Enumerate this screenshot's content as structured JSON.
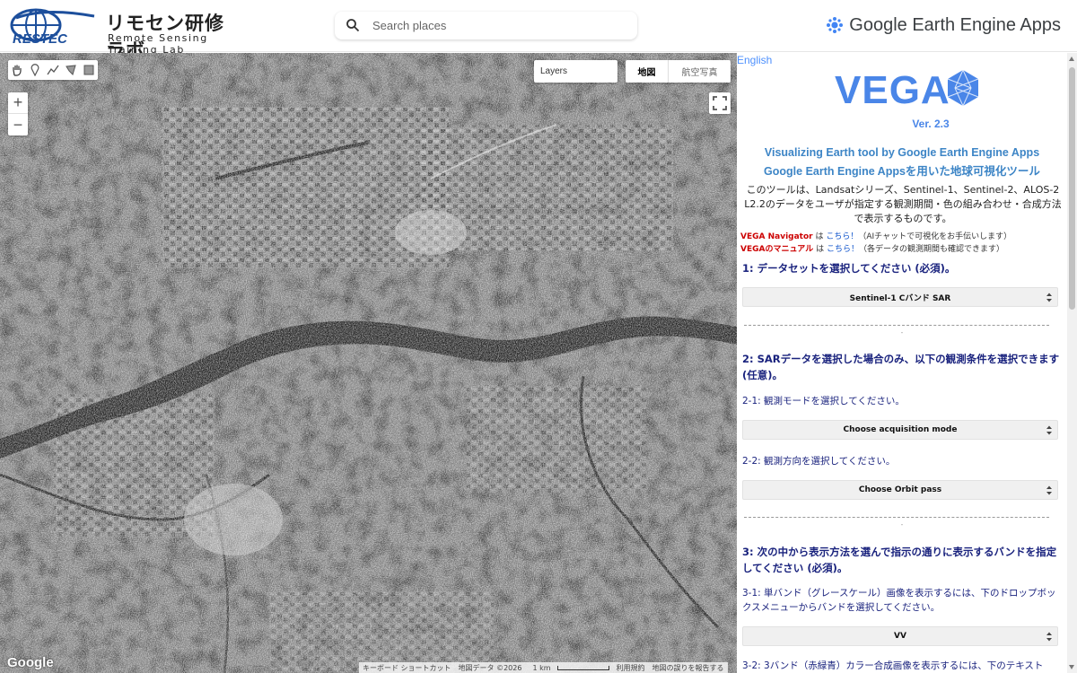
{
  "header": {
    "logo_brand": "RESTEC",
    "logo_jp": "リモセン研修ラボ",
    "logo_en": "Remote Sensing Training Lab",
    "search_placeholder": "Search places",
    "app_title": "Google Earth Engine Apps"
  },
  "map": {
    "draw_tools": [
      "hand-icon",
      "marker-icon",
      "polyline-icon",
      "polygon-icon",
      "rectangle-icon"
    ],
    "zoom_in": "+",
    "zoom_out": "−",
    "layers_label": "Layers",
    "map_types": {
      "map": "地図",
      "satellite": "航空写真"
    },
    "google_logo": "Google",
    "attribution": {
      "shortcuts": "キーボード ショートカット",
      "map_data": "地図データ ©2026",
      "scale": "1 km",
      "terms": "利用規約",
      "report": "地図の誤りを報告する"
    }
  },
  "panel": {
    "language_link": "English",
    "title": "VEGA",
    "version": "Ver. 2.3",
    "subtitle_en": "Visualizing Earth tool by Google Earth Engine Apps",
    "subtitle_jp": "Google Earth Engine Appsを用いた地球可視化ツール",
    "description": "このツールは、Landsatシリーズ、Sentinel-1、Sentinel-2、ALOS-2 L2.2のデータをユーザが指定する観測期間・色の組み合わせ・合成方法で表示するものです。",
    "links": [
      {
        "name": "VEGA Navigator",
        "mid": " は ",
        "link": "こちら！",
        "note": "（AIチャットで可視化をお手伝いします）"
      },
      {
        "name": "VEGAのマニュアル",
        "mid": " は ",
        "link": "こちら！",
        "note": "（各データの観測期間も確認できます）"
      }
    ],
    "step1": {
      "heading": "1: データセットを選択してください (必須)。",
      "selected": "Sentinel-1 Cバンド SAR"
    },
    "divider_dot": "-",
    "step2": {
      "heading": "2: SARデータを選択した場合のみ、以下の観測条件を選択できます (任意)。",
      "q1": "2-1: 観測モードを選択してください。",
      "q1_selected": "Choose acquisition mode",
      "q2": "2-2: 観測方向を選択してください。",
      "q2_selected": "Choose Orbit pass"
    },
    "step3": {
      "heading": "3: 次の中から表示方法を選んで指示の通りに表示するバンドを指定してください (必須)。",
      "q1": "3-1: 単バンド（グレースケール）画像を表示するには、下のドロップボックスメニューからバンドを選択してください。",
      "q1_selected": "VV",
      "q2": "3-2: 3バンド（赤緑青）カラー合成画像を表示するには、下のテキスト"
    }
  },
  "colors": {
    "vega_blue": "#4a86e8",
    "heading_navy": "#1a237e",
    "link_red": "#cc0000",
    "link_blue": "#1155cc"
  }
}
